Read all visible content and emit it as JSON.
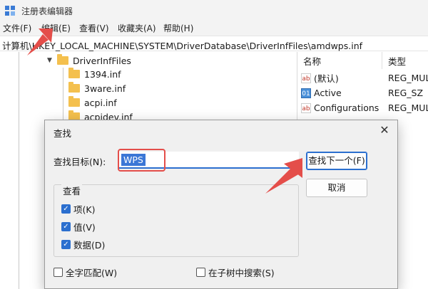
{
  "window": {
    "title": "注册表编辑器"
  },
  "menu": {
    "items": [
      "文件(F)",
      "编辑(E)",
      "查看(V)",
      "收藏夹(A)",
      "帮助(H)"
    ]
  },
  "address": {
    "path": "计算机\\HKEY_LOCAL_MACHINE\\SYSTEM\\DriverDatabase\\DriverInfFiles\\amdwps.inf"
  },
  "tree": {
    "parent": "DriverInfFiles",
    "children": [
      "1394.inf",
      "3ware.inf",
      "acpi.inf",
      "acpidev.inf"
    ]
  },
  "values": {
    "headers": {
      "name": "名称",
      "type": "类型"
    },
    "rows": [
      {
        "icon": "string-value-icon",
        "name": "(默认)",
        "type": "REG_MUL"
      },
      {
        "icon": "binary-value-icon",
        "name": "Active",
        "type": "REG_SZ"
      },
      {
        "icon": "string-value-icon",
        "name": "Configurations",
        "type": "REG_MUL"
      }
    ]
  },
  "dialog": {
    "title": "查找",
    "close_glyph": "✕",
    "find_label": "查找目标(N):",
    "find_value": "WPS",
    "find_next_label": "查找下一个(F)",
    "cancel_label": "取消",
    "lookin_label": "查看",
    "options": [
      {
        "label": "项(K)",
        "checked": true
      },
      {
        "label": "值(V)",
        "checked": true
      },
      {
        "label": "数据(D)",
        "checked": true
      }
    ],
    "match_whole": {
      "label": "全字匹配(W)",
      "checked": false
    },
    "in_subtree": {
      "label": "在子树中搜索(S)",
      "checked": false
    }
  },
  "colors": {
    "highlight": "#3b77d6",
    "annotation": "#e44e4a",
    "folder": "#f4c04e"
  }
}
